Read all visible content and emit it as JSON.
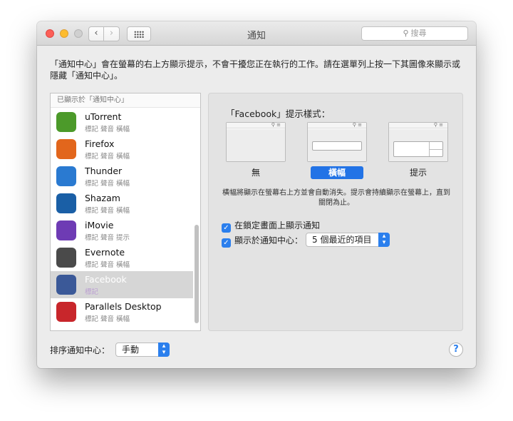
{
  "window": {
    "title": "通知",
    "search_placeholder": "搜尋"
  },
  "description": "「通知中心」會在螢幕的右上方顯示提示，不會干擾您正在執行的工作。請在選單列上按一下其圖像來顯示或隱藏「通知中心」。",
  "app_list": {
    "header": "已顯示於「通知中心」",
    "items": [
      {
        "name": "uTorrent",
        "sub": "標記 聲音 橫幅",
        "icon": "utorrent-icon",
        "color": "#4c9a2a"
      },
      {
        "name": "Firefox",
        "sub": "標記 聲音 橫幅",
        "icon": "firefox-icon",
        "color": "#e2661c"
      },
      {
        "name": "Thunder",
        "sub": "標記 聲音 橫幅",
        "icon": "thunder-icon",
        "color": "#2a7ad1"
      },
      {
        "name": "Shazam",
        "sub": "標記 聲音 橫幅",
        "icon": "shazam-icon",
        "color": "#1a5fa6"
      },
      {
        "name": "iMovie",
        "sub": "標記 聲音 提示",
        "icon": "imovie-icon",
        "color": "#6e3bb4"
      },
      {
        "name": "Evernote",
        "sub": "標記 聲音 橫幅",
        "icon": "evernote-icon",
        "color": "#4a4a4a"
      },
      {
        "name": "Facebook",
        "sub": "標記",
        "icon": "facebook-icon",
        "color": "#3b5998"
      },
      {
        "name": "Parallels Desktop",
        "sub": "標記 聲音 橫幅",
        "icon": "parallels-icon",
        "color": "#c8262b"
      }
    ],
    "selected_index": 6
  },
  "detail": {
    "style_title": "「Facebook」提示樣式：",
    "options": {
      "none": "無",
      "banner": "橫幅",
      "alert": "提示"
    },
    "selected_option": "banner",
    "style_description": "橫幅將顯示在螢幕右上方並會自動消失。提示會持續顯示在螢幕上，直到關閉為止。",
    "lock_screen_label": "在鎖定畫面上顯示通知",
    "show_in_center_label": "顯示於通知中心：",
    "recent_items_value": "5 個最近的項目"
  },
  "footer": {
    "sort_label": "排序通知中心：",
    "sort_value": "手動",
    "help_label": "?"
  },
  "colors": {
    "accent": "#2b7fed",
    "selected_row": "#d6d6d6"
  }
}
